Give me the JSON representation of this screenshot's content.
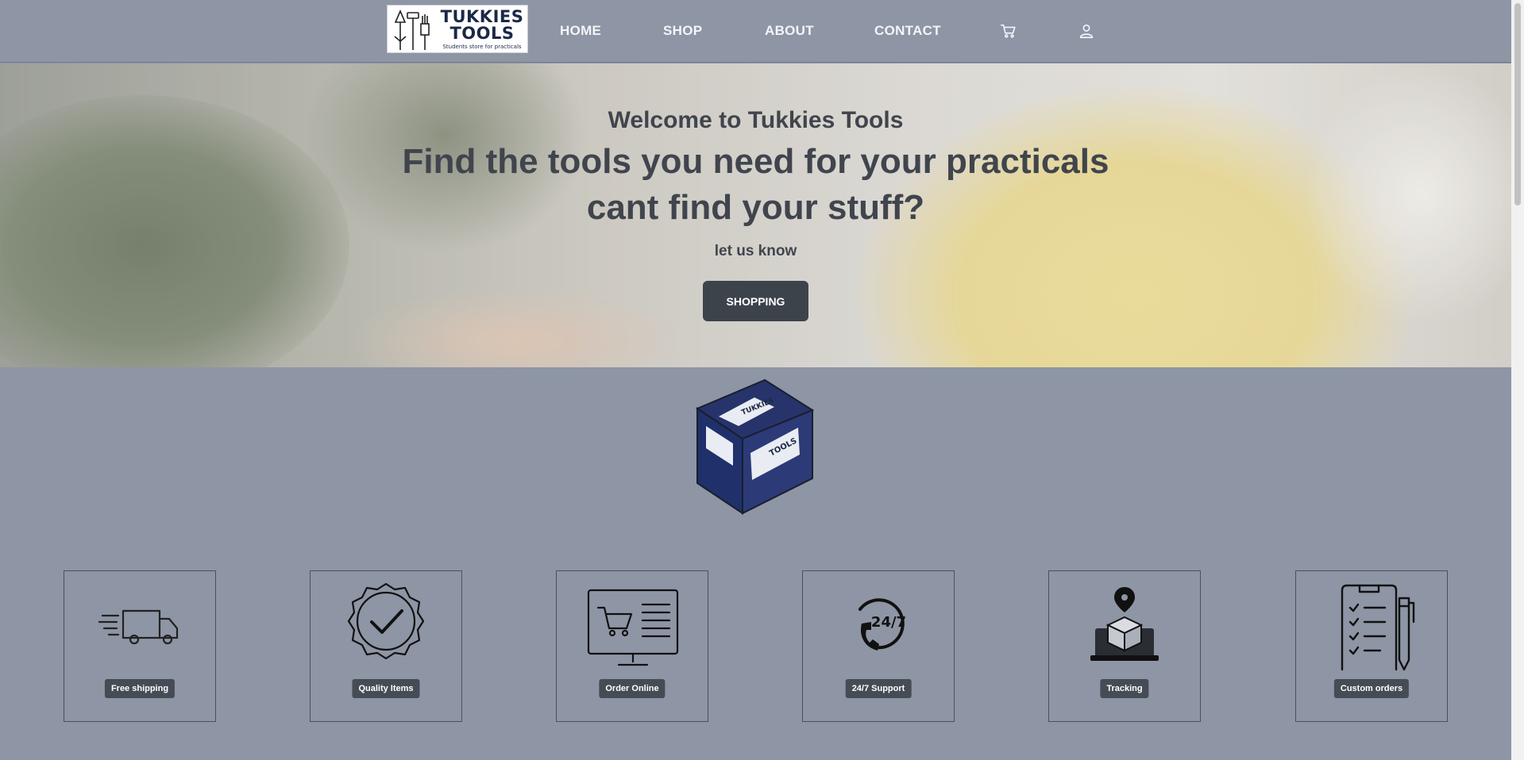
{
  "header": {
    "logo": {
      "title_line1": "TUKKIES",
      "title_line2": "TOOLS",
      "tagline": "Students store for practicals"
    },
    "nav": [
      {
        "label": "HOME"
      },
      {
        "label": "SHOP"
      },
      {
        "label": "ABOUT"
      },
      {
        "label": "CONTACT"
      }
    ],
    "icons": {
      "cart": "cart-icon",
      "account": "user-icon"
    }
  },
  "hero": {
    "welcome": "Welcome to Tukkies Tools",
    "heading_line1": "Find the tools you need for your practicals",
    "heading_line2": "cant find your stuff?",
    "subtext": "let us know",
    "button_label": "SHOPPING"
  },
  "cube": {
    "face_text_line1": "TUKKIES",
    "face_text_line2": "TOOLS"
  },
  "features": [
    {
      "label": "Free shipping",
      "icon": "delivery-truck-icon"
    },
    {
      "label": "Quality Items",
      "icon": "quality-badge-icon"
    },
    {
      "label": "Order Online",
      "icon": "online-cart-icon"
    },
    {
      "label": "24/7 Support",
      "icon": "support-phone-icon"
    },
    {
      "label": "Tracking",
      "icon": "tracking-icon"
    },
    {
      "label": "Custom orders",
      "icon": "clipboard-icon"
    }
  ],
  "colors": {
    "background": "#8e95a5",
    "button": "#3c434b",
    "brand": "#1b2847"
  }
}
